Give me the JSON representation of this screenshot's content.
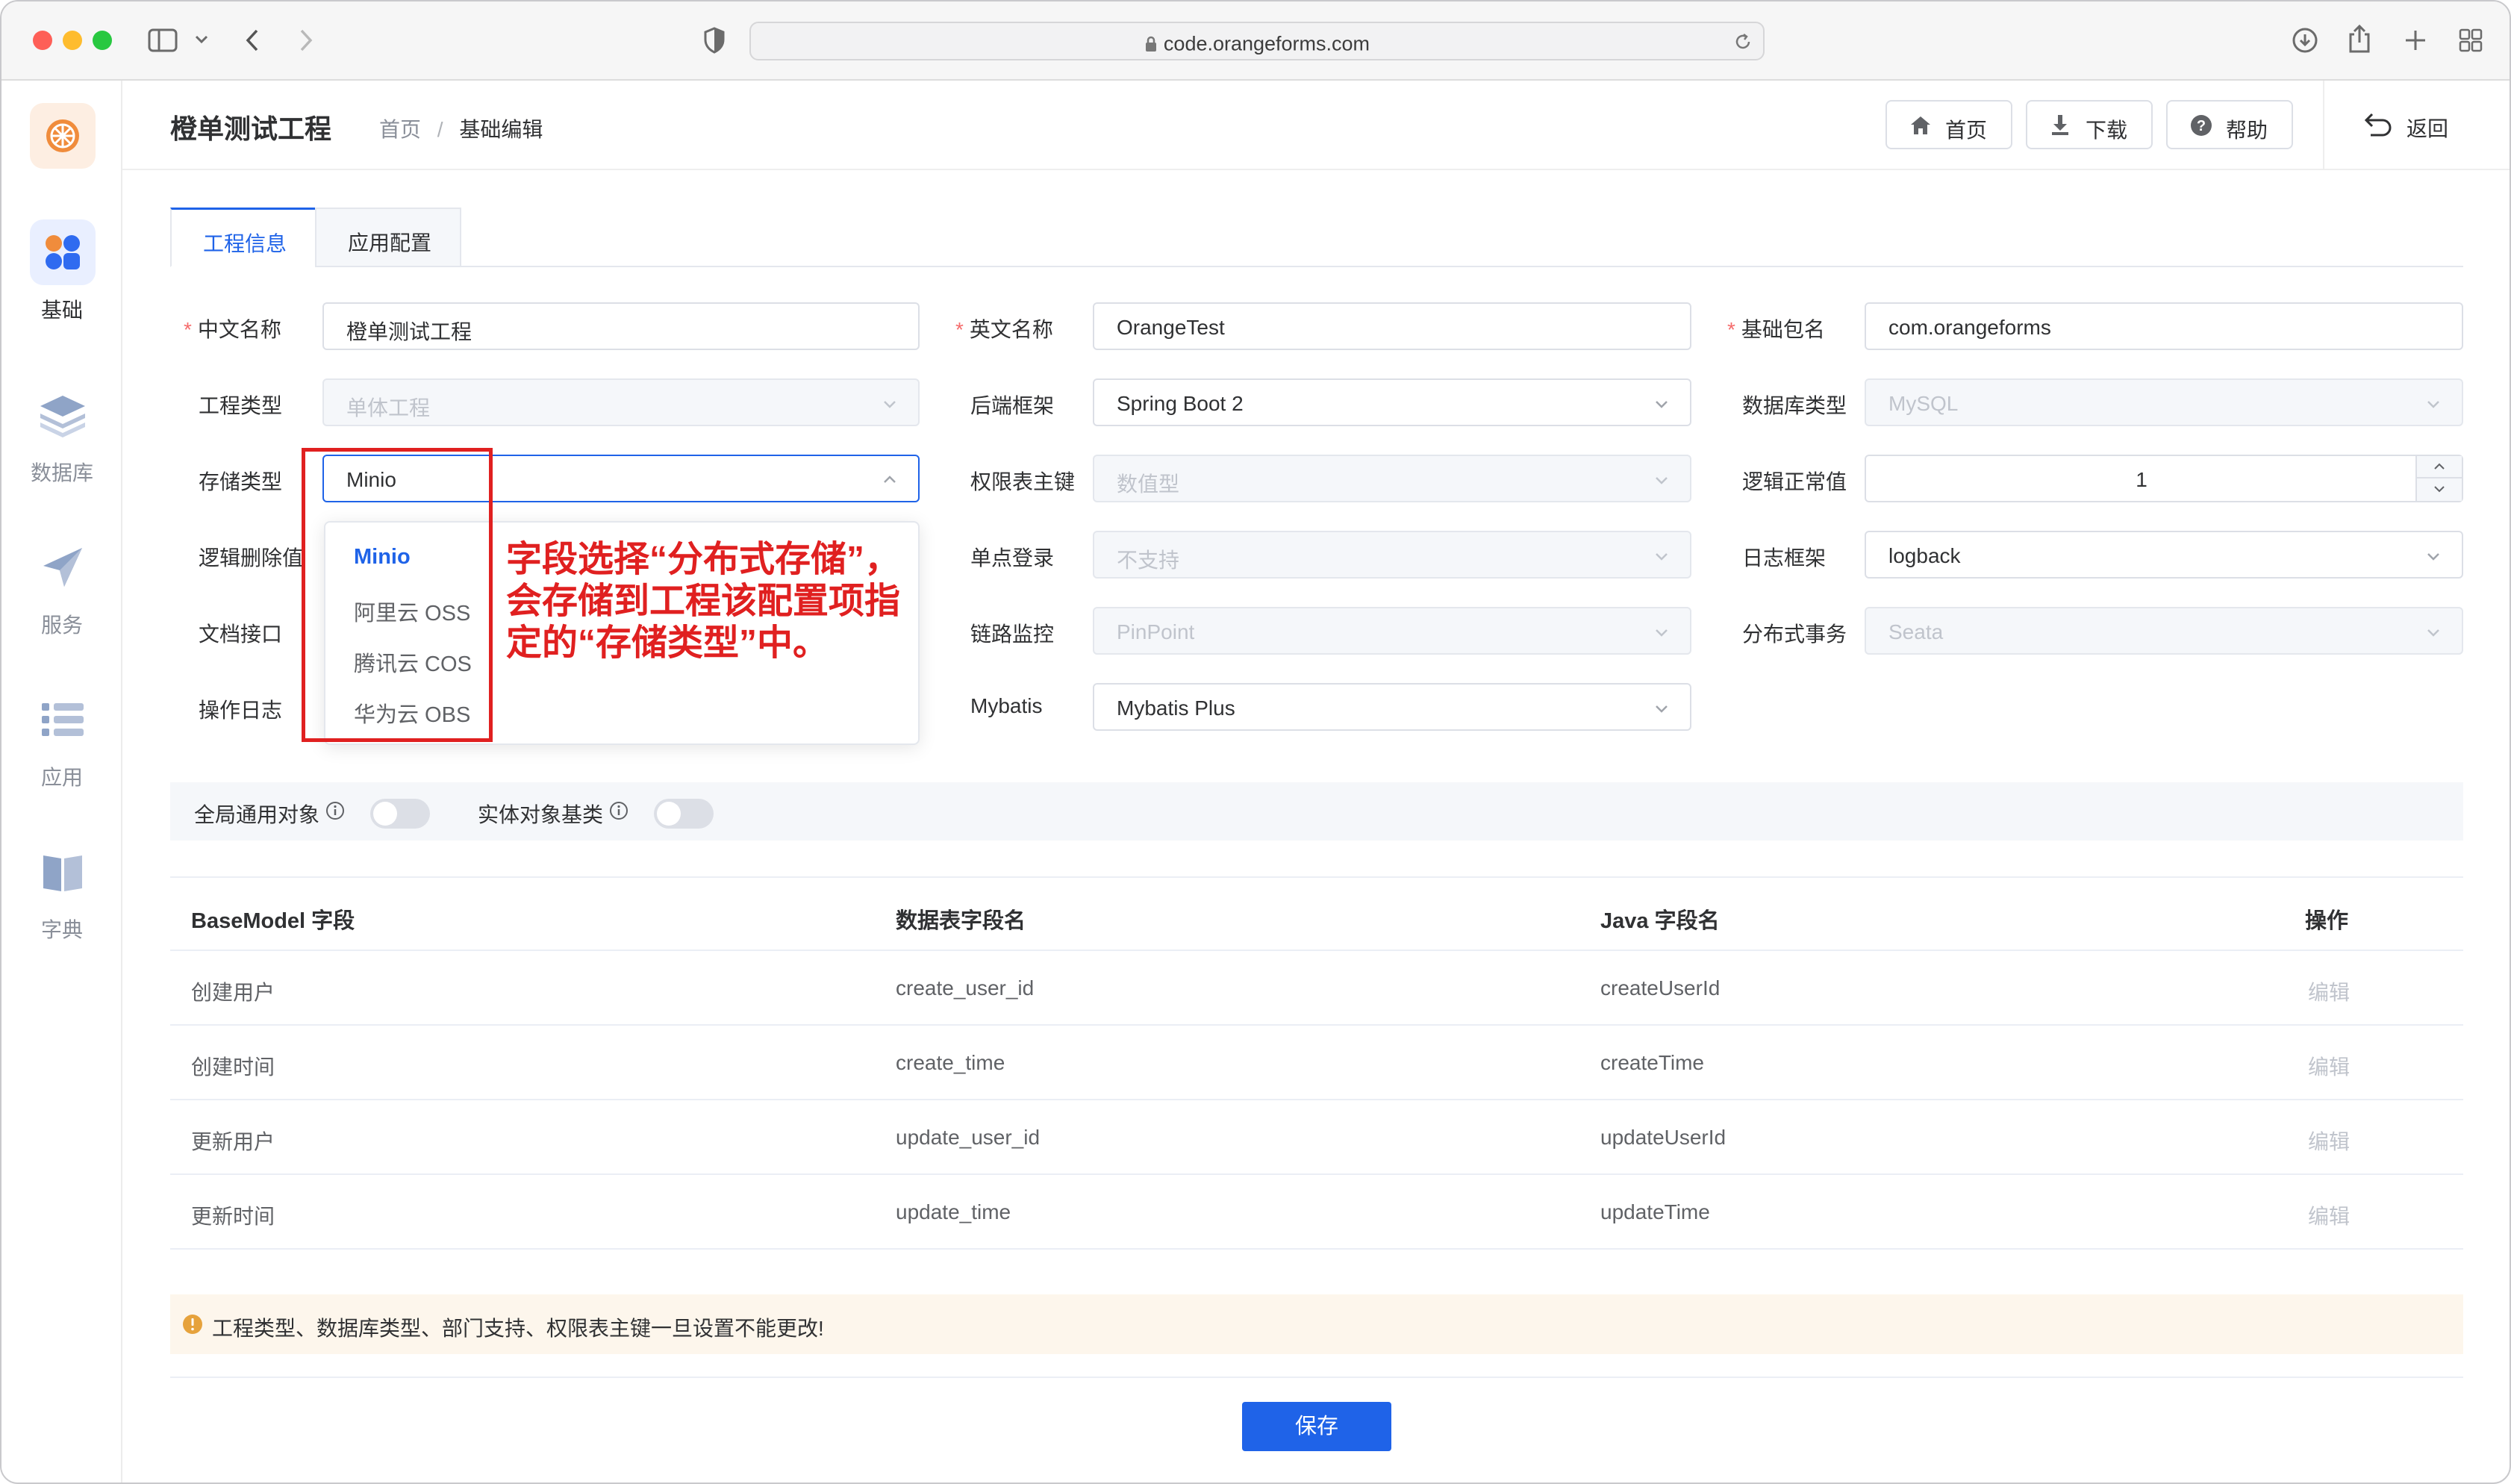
{
  "browser": {
    "url": "code.orangeforms.com"
  },
  "sidebar": {
    "items": [
      {
        "label": "基础",
        "icon": "grid-icon",
        "active": true
      },
      {
        "label": "数据库",
        "icon": "layers-icon",
        "active": false
      },
      {
        "label": "服务",
        "icon": "send-icon",
        "active": false
      },
      {
        "label": "应用",
        "icon": "list-icon",
        "active": false
      },
      {
        "label": "字典",
        "icon": "book-icon",
        "active": false
      }
    ]
  },
  "header": {
    "title": "橙单测试工程",
    "breadcrumb": [
      "首页",
      "基础编辑"
    ],
    "breadcrumb_sep": "/",
    "buttons": {
      "home": "首页",
      "download": "下载",
      "help": "帮助",
      "back": "返回"
    }
  },
  "tabs": [
    {
      "label": "工程信息",
      "active": true
    },
    {
      "label": "应用配置",
      "active": false
    }
  ],
  "form": {
    "chinese_name": {
      "label": "中文名称",
      "value": "橙单测试工程",
      "required": true
    },
    "english_name": {
      "label": "英文名称",
      "value": "OrangeTest",
      "required": true
    },
    "base_package": {
      "label": "基础包名",
      "value": "com.orangeforms",
      "required": true
    },
    "project_type": {
      "label": "工程类型",
      "value": "单体工程",
      "disabled": true
    },
    "backend_framework": {
      "label": "后端框架",
      "value": "Spring Boot 2"
    },
    "database_type": {
      "label": "数据库类型",
      "value": "MySQL",
      "disabled": true
    },
    "storage_type": {
      "label": "存储类型",
      "value": "Minio",
      "open": true
    },
    "permission_key": {
      "label": "权限表主键",
      "value": "数值型",
      "disabled": true
    },
    "logic_normal_value": {
      "label": "逻辑正常值",
      "value": "1"
    },
    "logic_delete_value": {
      "label": "逻辑删除值"
    },
    "sso": {
      "label": "单点登录",
      "value": "不支持",
      "disabled": true
    },
    "log_framework": {
      "label": "日志框架",
      "value": "logback"
    },
    "doc_interface": {
      "label": "文档接口"
    },
    "trace_monitor": {
      "label": "链路监控",
      "value": "PinPoint",
      "disabled": true
    },
    "distributed_tx": {
      "label": "分布式事务",
      "value": "Seata",
      "disabled": true
    },
    "operation_log": {
      "label": "操作日志"
    },
    "mybatis": {
      "label": "Mybatis",
      "value": "Mybatis Plus"
    }
  },
  "storage_dropdown": {
    "options": [
      {
        "label": "Minio",
        "selected": true
      },
      {
        "label": "阿里云 OSS",
        "selected": false
      },
      {
        "label": "腾讯云 COS",
        "selected": false
      },
      {
        "label": "华为云 OBS",
        "selected": false
      }
    ]
  },
  "annotation": "字段选择“分布式存储”，会存储到工程该配置项指定的“存储类型”中。",
  "switches": [
    {
      "label": "全局通用对象",
      "on": false
    },
    {
      "label": "实体对象基类",
      "on": false
    }
  ],
  "table": {
    "headers": [
      "BaseModel 字段",
      "数据表字段名",
      "Java 字段名",
      "操作"
    ],
    "rows": [
      {
        "field": "创建用户",
        "column": "create_user_id",
        "java": "createUserId",
        "action": "编辑"
      },
      {
        "field": "创建时间",
        "column": "create_time",
        "java": "createTime",
        "action": "编辑"
      },
      {
        "field": "更新用户",
        "column": "update_user_id",
        "java": "updateUserId",
        "action": "编辑"
      },
      {
        "field": "更新时间",
        "column": "update_time",
        "java": "updateTime",
        "action": "编辑"
      }
    ]
  },
  "warning": "工程类型、数据库类型、部门支持、权限表主键一旦设置不能更改!",
  "save_label": "保存",
  "colors": {
    "primary": "#1f63e8",
    "brand_orange": "#f08c3c",
    "danger": "#e02020",
    "warning": "#e6a23c"
  }
}
